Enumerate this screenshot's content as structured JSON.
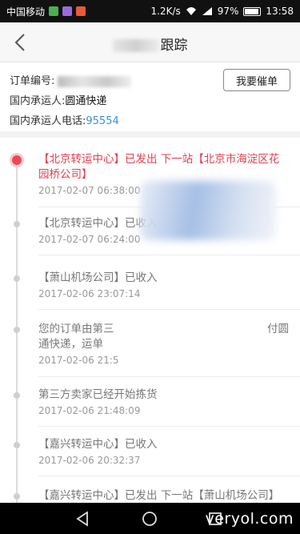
{
  "status_bar": {
    "carrier": "中国移动",
    "speed": "1.2K/s",
    "battery": "97%",
    "time": "13:58"
  },
  "header": {
    "title_suffix": "跟踪"
  },
  "order": {
    "number_label": "订单编号:",
    "carrier_label": "国内承运人:",
    "carrier_value": "圆通快递",
    "phone_label": "国内承运人电话:",
    "phone_value": "95554",
    "urge_button": "我要催单"
  },
  "tracking": [
    {
      "text": "【北京转运中心】已发出 下一站【北京市海淀区花园桥公司】",
      "time": "2017-02-07 06:38:00"
    },
    {
      "text": "【北京转运中心】已收入",
      "time": "2017-02-07 06:24:00"
    },
    {
      "text": "【萧山机场公司】已收入",
      "time": "2017-02-06 23:07:14"
    },
    {
      "text": "您的订单由第三",
      "text2": "付圆",
      "text3": "通快递，运单",
      "time": "2017-02-06 21:5"
    },
    {
      "text": "第三方卖家已经开始拣货",
      "time": "2017-02-06 21:48:09"
    },
    {
      "text": "【嘉兴转运中心】已收入",
      "time": "2017-02-06 20:32:37"
    },
    {
      "text": "【嘉兴转运中心】已发出 下一站【萧山机场公司】"
    }
  ],
  "watermark": "veryol.com",
  "colors": {
    "accent": "#e04050",
    "link": "#3a8fd6"
  }
}
